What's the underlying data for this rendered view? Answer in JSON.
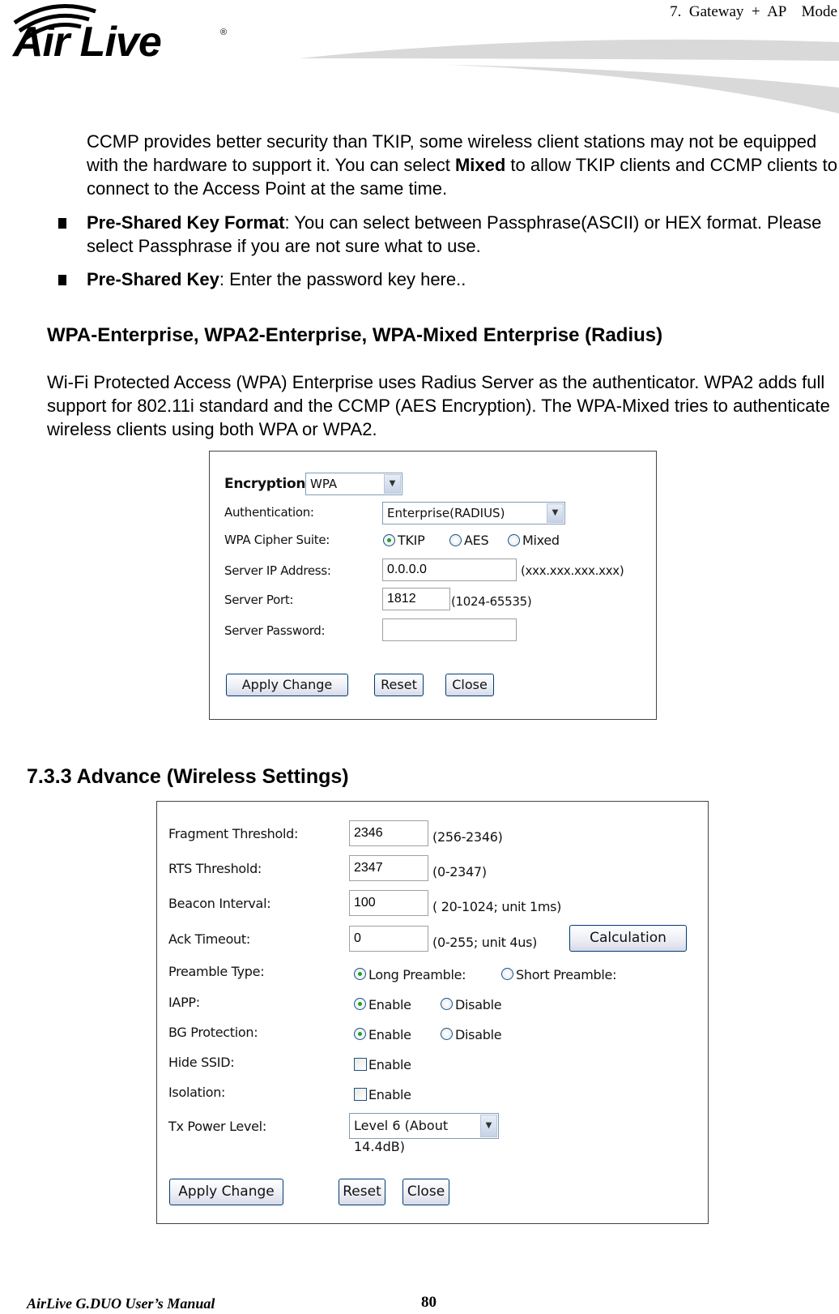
{
  "header": {
    "logo_text": "Air Live",
    "logo_registered": "®",
    "chapter": "7.  Gateway  +  AP    Mode"
  },
  "content": {
    "intro_paragraph": {
      "part1": "CCMP provides better security than TKIP, some wireless client stations may not be equipped with the hardware to support it. You can select ",
      "bold": "Mixed",
      "part2": " to allow TKIP clients and CCMP clients to connect to the Access Point at the same time."
    },
    "bullets": [
      {
        "term": "Pre-Shared Key Format",
        "text": ":    You can select between Passphrase(ASCII) or HEX format.    Please select Passphrase if you are not sure what to use."
      },
      {
        "term": "Pre-Shared Key",
        "text": ":    Enter the password key here.."
      }
    ],
    "wpa_heading": "WPA-Enterprise, WPA2-Enterprise, WPA-Mixed Enterprise (Radius)",
    "wpa_paragraph": "Wi-Fi Protected Access (WPA) Enterprise uses Radius Server as the authenticator. WPA2 adds full support for 802.11i standard and the CCMP (AES Encryption).    The WPA-Mixed tries to authenticate wireless clients using both WPA or WPA2.",
    "advance_heading": "7.3.3 Advance (Wireless Settings)"
  },
  "security_form": {
    "encryption": {
      "label": "Encryption:",
      "value": "WPA"
    },
    "authentication": {
      "label": "Authentication:",
      "value": "Enterprise(RADIUS)"
    },
    "cipher_suite": {
      "label": "WPA Cipher Suite:",
      "options": [
        "TKIP",
        "AES",
        "Mixed"
      ],
      "selected": "TKIP"
    },
    "server_ip": {
      "label": "Server IP Address:",
      "value": "0.0.0.0",
      "hint": "(xxx.xxx.xxx.xxx)"
    },
    "server_port": {
      "label": "Server Port:",
      "value": "1812",
      "hint": "(1024-65535)"
    },
    "server_password": {
      "label": "Server Password:",
      "value": ""
    },
    "buttons": {
      "apply": "Apply Change",
      "reset": "Reset",
      "close": "Close"
    }
  },
  "advanced_form": {
    "fragment_threshold": {
      "label": "Fragment Threshold:",
      "value": "2346",
      "hint": "(256-2346)"
    },
    "rts_threshold": {
      "label": "RTS Threshold:",
      "value": "2347",
      "hint": "(0-2347)"
    },
    "beacon_interval": {
      "label": "Beacon Interval:",
      "value": "100",
      "hint": "( 20-1024; unit 1ms)"
    },
    "ack_timeout": {
      "label": "Ack Timeout:",
      "value": "0",
      "hint": "(0-255; unit 4us)",
      "button": "Calculation"
    },
    "preamble_type": {
      "label": "Preamble Type:",
      "options": [
        "Long Preamble:",
        "Short Preamble:"
      ],
      "selected": "Long Preamble:"
    },
    "iapp": {
      "label": "IAPP:",
      "options": [
        "Enable",
        "Disable"
      ],
      "selected": "Enable"
    },
    "bg_protection": {
      "label": "BG Protection:",
      "options": [
        "Enable",
        "Disable"
      ],
      "selected": "Enable"
    },
    "hide_ssid": {
      "label": "Hide SSID:",
      "option": "Enable",
      "checked": false
    },
    "isolation": {
      "label": "Isolation:",
      "option": "Enable",
      "checked": false
    },
    "tx_power": {
      "label": "Tx Power Level:",
      "value": "Level 6 (About 14.4dB)"
    },
    "buttons": {
      "apply": "Apply Change",
      "reset": "Reset",
      "close": "Close"
    }
  },
  "footer": {
    "manual_title": "AirLive G.DUO User’s Manual",
    "page_number": "80"
  }
}
